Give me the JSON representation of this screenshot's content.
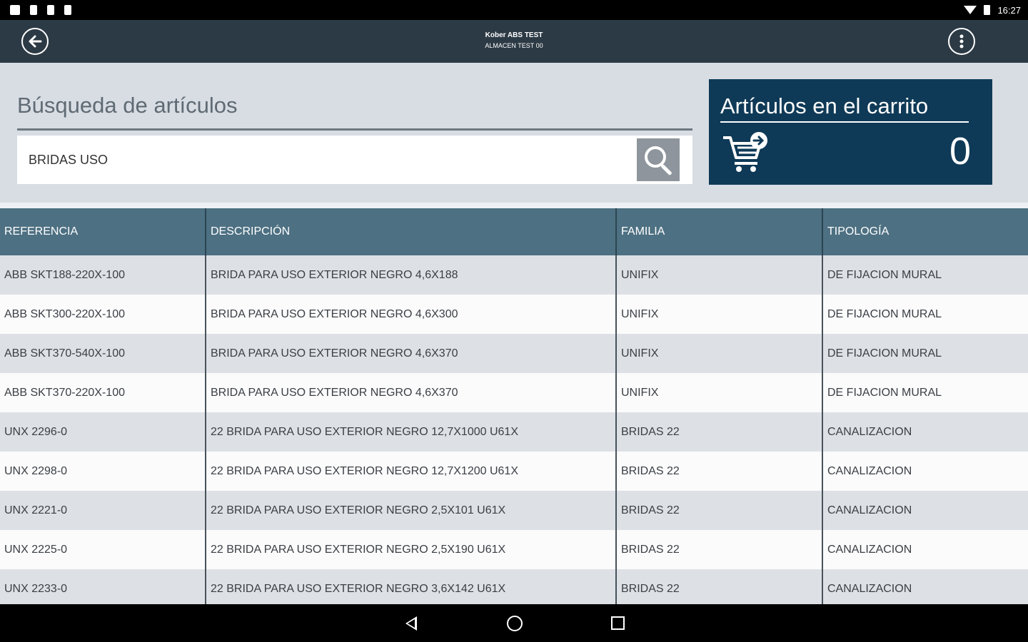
{
  "status_bar": {
    "time": "16:27",
    "left_icons": [
      "screenshot-icon",
      "usb-icon",
      "file-icon",
      "android-icon"
    ],
    "right_icons": [
      "wifi-icon",
      "battery-icon"
    ]
  },
  "app_bar": {
    "title": "Kober ABS TEST",
    "subtitle": "ALMACEN TEST 00",
    "back_icon": "arrow-left-circle",
    "menu_icon": "more-vertical-circle"
  },
  "search": {
    "heading": "Búsqueda de artículos",
    "query": "BRIDAS USO",
    "button_icon": "magnifier"
  },
  "cart": {
    "title": "Artículos en el carrito",
    "count": "0",
    "icon": "cart-arrow-icon"
  },
  "table": {
    "headers": [
      "REFERENCIA",
      "DESCRIPCIÓN",
      "FAMILIA",
      "TIPOLOGÍA"
    ],
    "rows": [
      [
        "ABB SKT188-220X-100",
        "BRIDA PARA USO EXTERIOR NEGRO 4,6X188",
        "UNIFIX",
        "DE FIJACION MURAL"
      ],
      [
        "ABB SKT300-220X-100",
        "BRIDA PARA USO EXTERIOR NEGRO 4,6X300",
        "UNIFIX",
        "DE FIJACION MURAL"
      ],
      [
        "ABB SKT370-540X-100",
        "BRIDA PARA USO EXTERIOR NEGRO 4,6X370",
        "UNIFIX",
        "DE FIJACION MURAL"
      ],
      [
        "ABB SKT370-220X-100",
        "BRIDA PARA USO EXTERIOR NEGRO 4,6X370",
        "UNIFIX",
        "DE FIJACION MURAL"
      ],
      [
        "UNX 2296-0",
        "22 BRIDA PARA USO EXTERIOR NEGRO 12,7X1000 U61X",
        "BRIDAS 22",
        "CANALIZACION"
      ],
      [
        "UNX 2298-0",
        "22 BRIDA PARA USO EXTERIOR NEGRO 12,7X1200 U61X",
        "BRIDAS 22",
        "CANALIZACION"
      ],
      [
        "UNX 2221-0",
        "22 BRIDA PARA USO EXTERIOR NEGRO 2,5X101 U61X",
        "BRIDAS 22",
        "CANALIZACION"
      ],
      [
        "UNX 2225-0",
        "22 BRIDA PARA USO EXTERIOR NEGRO 2,5X190 U61X",
        "BRIDAS 22",
        "CANALIZACION"
      ],
      [
        "UNX 2233-0",
        "22 BRIDA PARA USO EXTERIOR NEGRO 3,6X142 U61X",
        "BRIDAS 22",
        "CANALIZACION"
      ]
    ]
  },
  "nav_bar": {
    "buttons": [
      "back-triangle",
      "home-circle",
      "recents-square"
    ]
  },
  "colors": {
    "app_bar": "#2c3a45",
    "panel_bg": "#d8dde3",
    "cart_bg": "#0f3a57",
    "table_header": "#4d7082"
  }
}
